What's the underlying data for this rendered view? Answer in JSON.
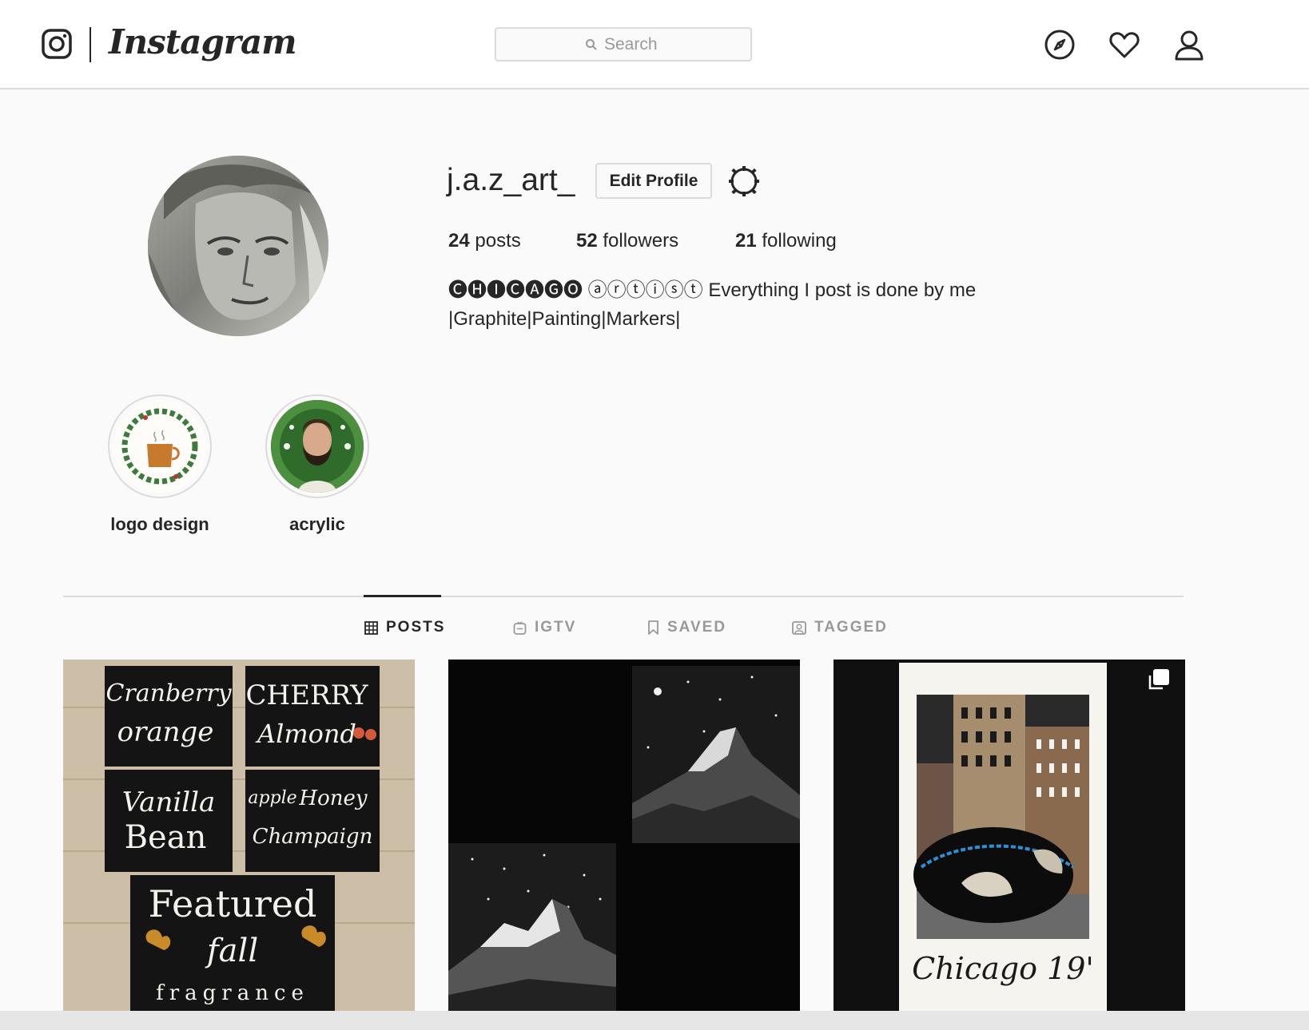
{
  "nav": {
    "logo_text": "Instagram",
    "search_placeholder": "Search",
    "icons": [
      "instagram-glyph-icon",
      "search-icon",
      "compass-icon",
      "heart-icon",
      "user-icon"
    ]
  },
  "profile": {
    "username": "j.a.z_art_",
    "edit_label": "Edit Profile",
    "stats": {
      "posts_count": "24",
      "posts_label": "posts",
      "followers_count": "52",
      "followers_label": "followers",
      "following_count": "21",
      "following_label": "following"
    },
    "bio_circled": "🅒🅗🅘🅒🅐🅖🅞 ⓐⓡⓣⓘⓢⓣ",
    "bio_line1": "Everything I post is done by me",
    "bio_line2": "|Graphite|Painting|Markers|"
  },
  "highlights": [
    {
      "label": "logo design"
    },
    {
      "label": "acrylic"
    }
  ],
  "tabs": [
    {
      "label": "POSTS",
      "active": true
    },
    {
      "label": "IGTV",
      "active": false
    },
    {
      "label": "SAVED",
      "active": false
    },
    {
      "label": "TAGGED",
      "active": false
    }
  ],
  "posts": [
    {
      "lettering": [
        "Cranberry",
        "orange",
        "CHERRY",
        "Almond",
        "Vanilla",
        "Bean",
        "apple",
        "Honey",
        "Champaign",
        "Featured",
        "fall",
        "fragrance"
      ]
    },
    {
      "lettering": []
    },
    {
      "lettering": [
        "Chicago 19'"
      ]
    }
  ],
  "colors": {
    "background": "#fafafa",
    "text": "#262626",
    "border": "#dbdbdb",
    "muted": "#999999"
  }
}
